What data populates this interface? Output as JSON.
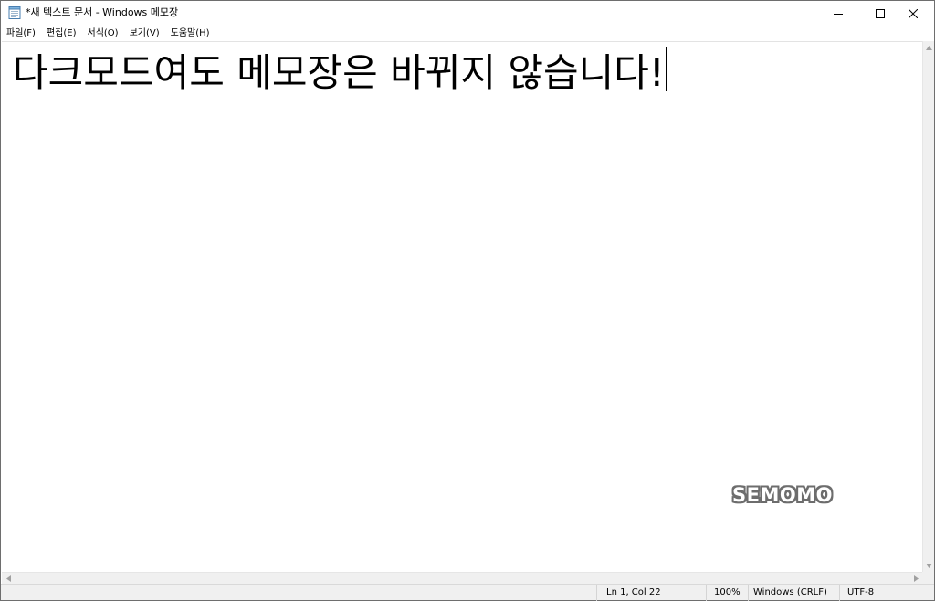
{
  "window": {
    "title": "*새 텍스트 문서 - Windows 메모장",
    "app_icon": "notepad-icon",
    "caption_buttons": [
      "minimize-icon",
      "maximize-icon",
      "close-icon"
    ]
  },
  "menu": {
    "items": [
      {
        "label": "파일(F)"
      },
      {
        "label": "편집(E)"
      },
      {
        "label": "서식(O)"
      },
      {
        "label": "보기(V)"
      },
      {
        "label": "도움말(H)"
      }
    ]
  },
  "editor": {
    "content": "다크모드여도 메모장은 바뀌지 않습니다!",
    "background_color": "#ffffff",
    "text_color": "#000000"
  },
  "status": {
    "position": "Ln 1, Col 22",
    "zoom": "100%",
    "line_ending": "Windows (CRLF)",
    "encoding": "UTF-8"
  },
  "watermark": {
    "text": "SEMOMO"
  }
}
